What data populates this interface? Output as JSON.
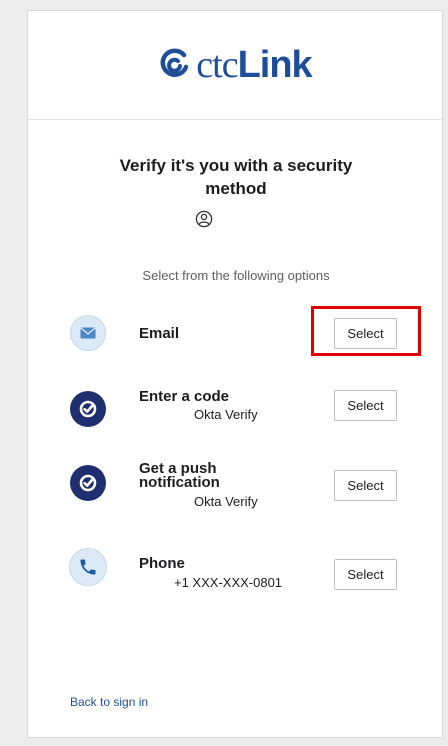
{
  "header": {
    "logo_prefix": "ctc",
    "logo_suffix": "Link",
    "brand_color": "#1e4e98"
  },
  "page": {
    "title": "Verify it's you with a security method",
    "subtitle": "Select from the following options"
  },
  "options": [
    {
      "name": "Email",
      "detail": "",
      "button": "Select",
      "icon": "envelope-icon",
      "highlighted": true
    },
    {
      "name": "Enter a code",
      "detail": "Okta Verify",
      "button": "Select",
      "icon": "okta-verify-icon"
    },
    {
      "name_line1": "Get a push",
      "name_line2": "notification",
      "detail": "Okta Verify",
      "button": "Select",
      "icon": "okta-verify-icon"
    },
    {
      "name": "Phone",
      "detail": "+1 XXX-XXX-0801",
      "button": "Select",
      "icon": "phone-icon"
    }
  ],
  "footer": {
    "back_link": "Back to sign in"
  },
  "colors": {
    "highlight": "#e00000",
    "icon_dark": "#1e2e6e",
    "icon_light": "#dbeaf6"
  }
}
